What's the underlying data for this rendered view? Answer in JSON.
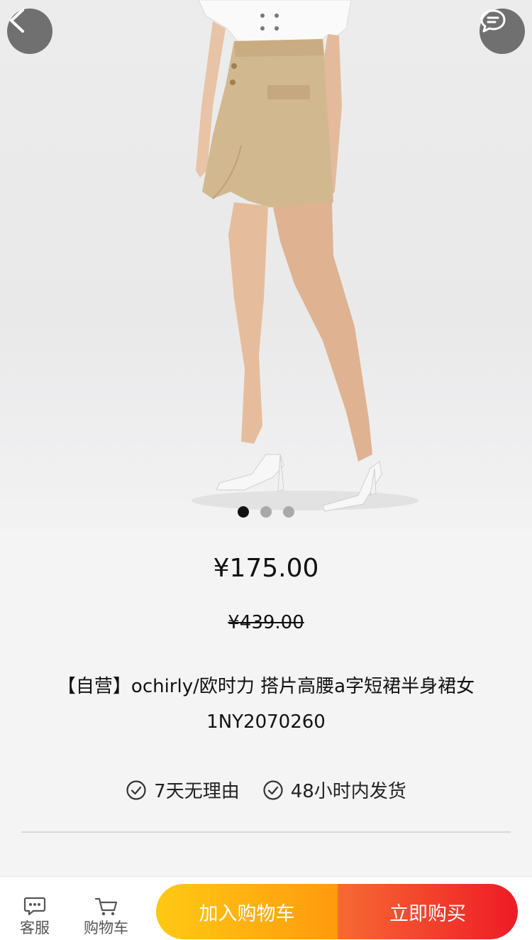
{
  "product": {
    "price": "¥175.00",
    "original_price": "¥439.00",
    "title": "【自营】ochirly/欧时力 搭片高腰a字短裙半身裙女1NY2070260",
    "guarantees": [
      {
        "label": "7天无理由",
        "icon": "check-circle-icon"
      },
      {
        "label": "48小时内发货",
        "icon": "check-circle-icon"
      }
    ]
  },
  "gallery": {
    "image_count": 3,
    "active_index": 0
  },
  "bottom_bar": {
    "service_label": "客服",
    "cart_label": "购物车",
    "add_to_cart_label": "加入购物车",
    "buy_now_label": "立即购买"
  },
  "colors": {
    "add_to_cart_start": "#ffc914",
    "add_to_cart_end": "#ff9a0e",
    "buy_now_start": "#f66a33",
    "buy_now_end": "#ee1b26"
  }
}
